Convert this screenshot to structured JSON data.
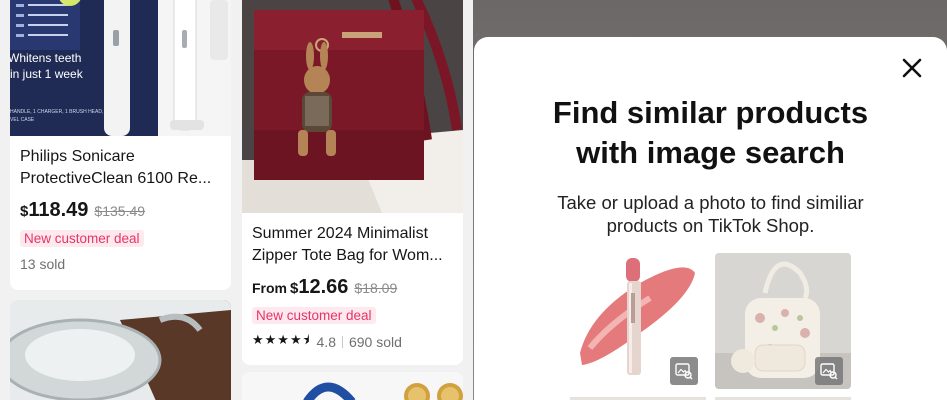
{
  "feed": {
    "products": [
      {
        "title_line1": "Philips Sonicare",
        "title_line2": "ProtectiveClean 6100 Re...",
        "price_currency": "$",
        "price": "118.49",
        "original_price": "$135.49",
        "deal": "New customer deal",
        "sold": "13 sold",
        "image_text": {
          "line1": "Whitens teeth",
          "line2": "in just 1 week",
          "footer1": "HANDLE, 1 CHARGER, 1 BRUSH HEAD,",
          "footer2": "VEL CASE"
        }
      },
      {
        "title_line1": "Summer 2024 Minimalist",
        "title_line2": "Zipper Tote Bag for Wom...",
        "price_prefix": "From",
        "price_currency": "$",
        "price": "12.66",
        "original_price": "$18.09",
        "deal": "New customer deal",
        "stars": "★★★★⯨",
        "rating": "4.8",
        "sold": "690 sold"
      }
    ]
  },
  "sheet": {
    "close_icon": "close-icon",
    "title_line1": "Find similar products",
    "title_line2": "with image search",
    "subtitle_line1": "Take or upload a photo to find similiar",
    "subtitle_line2": "products on TikTok Shop.",
    "sample_images": [
      {
        "name": "lip-gloss-sample",
        "icon": "image-search-icon"
      },
      {
        "name": "backpack-sample",
        "icon": "image-search-icon"
      }
    ]
  },
  "colors": {
    "deal_text": "#e8336b",
    "deal_bg": "#fde9ee",
    "background": "#f1f1f1",
    "sheet": "#ffffff"
  }
}
